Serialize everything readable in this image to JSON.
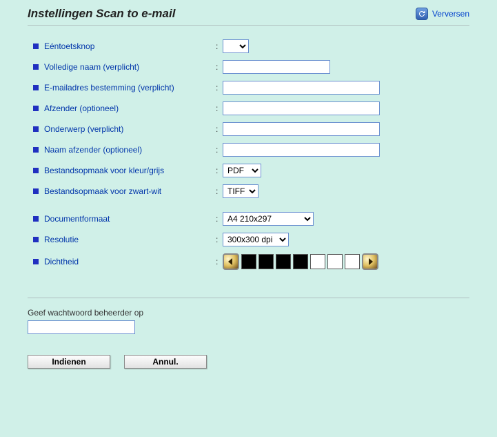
{
  "header": {
    "title": "Instellingen Scan to e-mail",
    "refresh": "Verversen"
  },
  "fields": {
    "one_touch": {
      "label": "Eéntoetsknop",
      "value": ""
    },
    "full_name": {
      "label": "Volledige naam (verplicht)",
      "value": ""
    },
    "dest_email": {
      "label": "E-mailadres bestemming (verplicht)",
      "value": ""
    },
    "sender": {
      "label": "Afzender (optioneel)",
      "value": ""
    },
    "subject": {
      "label": "Onderwerp (verplicht)",
      "value": ""
    },
    "sender_name": {
      "label": "Naam afzender (optioneel)",
      "value": ""
    },
    "format_color": {
      "label": "Bestandsopmaak voor kleur/grijs",
      "value": "PDF"
    },
    "format_bw": {
      "label": "Bestandsopmaak voor zwart-wit",
      "value": "TIFF"
    },
    "doc_format": {
      "label": "Documentformaat",
      "value": "A4 210x297"
    },
    "resolution": {
      "label": "Resolutie",
      "value": "300x300 dpi"
    },
    "density": {
      "label": "Dichtheid"
    }
  },
  "password": {
    "label": "Geef wachtwoord beheerder op",
    "value": ""
  },
  "buttons": {
    "submit": "Indienen",
    "cancel": "Annul."
  }
}
